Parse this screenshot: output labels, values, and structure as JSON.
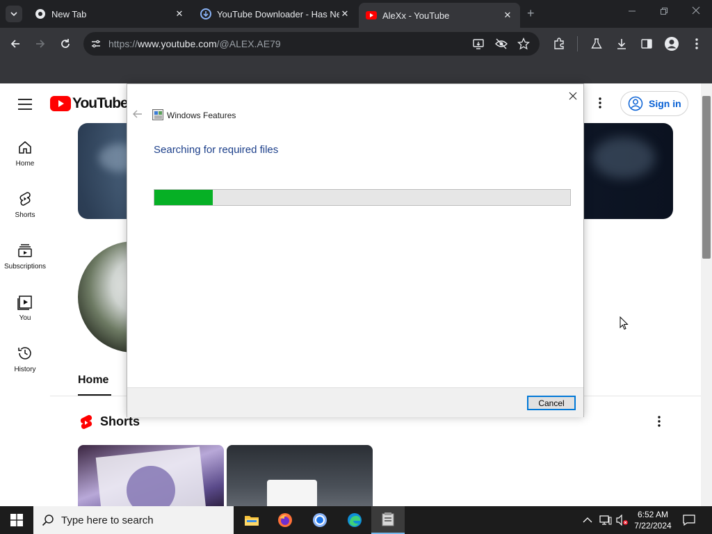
{
  "browser": {
    "tabs": [
      {
        "title": "New Tab",
        "active": false
      },
      {
        "title": "YouTube Downloader - Has Ne",
        "active": false
      },
      {
        "title": "AleXx - YouTube",
        "active": true
      }
    ],
    "new_tab_symbol": "+",
    "close_symbol": "✕",
    "url_prefix": "https://",
    "url_host": "www.youtube.com",
    "url_path": "/@ALEX.AE79"
  },
  "youtube": {
    "logo_text": "YouTube",
    "sign_in": "Sign in",
    "nav": [
      {
        "label": "Home",
        "icon": "home-icon"
      },
      {
        "label": "Shorts",
        "icon": "shorts-icon"
      },
      {
        "label": "Subscriptions",
        "icon": "subscriptions-icon"
      },
      {
        "label": "You",
        "icon": "you-icon"
      },
      {
        "label": "History",
        "icon": "history-icon"
      }
    ],
    "channel_tab": "Home",
    "section_title": "Shorts"
  },
  "dialog": {
    "title": "Windows Features",
    "status": "Searching for required files",
    "progress": 0.14,
    "cancel": "Cancel"
  },
  "taskbar": {
    "search_placeholder": "Type here to search",
    "time": "6:52 AM",
    "date": "7/22/2024"
  },
  "colors": {
    "youtube_red": "#ff0000",
    "progress_green": "#06b025",
    "link_blue": "#065fd4",
    "focus_blue": "#0078d7"
  }
}
